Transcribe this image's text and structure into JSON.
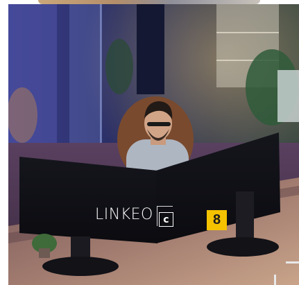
{
  "logo": {
    "brand_text": "LINKEO",
    "mark_letter": "c"
  },
  "page_badge": {
    "number": "8",
    "color": "#f5c200"
  },
  "photo": {
    "subject": "man-working-at-dual-monitors-icon"
  }
}
